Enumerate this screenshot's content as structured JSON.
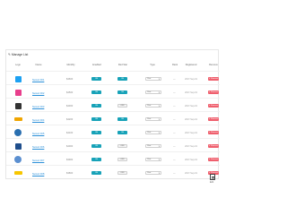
{
  "panel": {
    "title": "Manage List",
    "pencil_icon": "pencil-icon"
  },
  "columns": [
    "Logo",
    "Name",
    "Monthly",
    "Enabled",
    "Red Star",
    "Type",
    "Rank",
    "Registered",
    "Remove"
  ],
  "rows": [
    {
      "logo": {
        "icon": "twitter-logo",
        "color": "#1da1f2",
        "shape": "sq"
      },
      "name": "Netsol 001",
      "monthly": "$4600",
      "enabled": "ON",
      "redstar": "ON",
      "type": "Eco",
      "rank": "—",
      "date": "2017-Sep-01",
      "remove": "Remove"
    },
    {
      "logo": {
        "icon": "colorful-logo",
        "color": "#e83e8c",
        "shape": "sq"
      },
      "name": "Netsol 002",
      "monthly": "$4500",
      "enabled": "ON",
      "redstar": "ON",
      "type": "Eco",
      "rank": "—",
      "date": "2017-Sep-01",
      "remove": "Remove"
    },
    {
      "logo": {
        "icon": "b-logo",
        "color": "#333333",
        "shape": "sq"
      },
      "name": "Netsol 003",
      "monthly": "$4300",
      "enabled": "ON",
      "redstar": "OFF",
      "type": "Eco",
      "rank": "—",
      "date": "2017-Sep-01",
      "remove": "Remove"
    },
    {
      "logo": {
        "icon": "bar-logo",
        "color": "#f0a500",
        "shape": "bar"
      },
      "name": "Netsol 004",
      "monthly": "$4200",
      "enabled": "ON",
      "redstar": "ON",
      "type": "Eco",
      "rank": "—",
      "date": "2017-Sep-01",
      "remove": "Remove"
    },
    {
      "logo": {
        "icon": "circle-logo",
        "color": "#2a6fb0",
        "shape": "circ"
      },
      "name": "Netsol 005",
      "monthly": "$4100",
      "enabled": "ON",
      "redstar": "ON",
      "type": "Eco",
      "rank": "—",
      "date": "2017-Sep-01",
      "remove": "Remove"
    },
    {
      "logo": {
        "icon": "emblem-logo",
        "color": "#1f4e8c",
        "shape": "sq"
      },
      "name": "Netsol 006",
      "monthly": "$4000",
      "enabled": "ON",
      "redstar": "OFF",
      "type": "Eco",
      "rank": "—",
      "date": "2017-Sep-01",
      "remove": "Remove"
    },
    {
      "logo": {
        "icon": "round-logo",
        "color": "#5b8fd0",
        "shape": "circ"
      },
      "name": "Netsol 007",
      "monthly": "$3900",
      "enabled": "ON",
      "redstar": "OFF",
      "type": "Eco",
      "rank": "—",
      "date": "2017-Sep-01",
      "remove": "Remove"
    },
    {
      "logo": {
        "icon": "yellow-logo",
        "color": "#f7c600",
        "shape": "bar"
      },
      "name": "Netsol 008",
      "monthly": "$3800",
      "enabled": "ON",
      "redstar": "OFF",
      "type": "Eco",
      "rank": "—",
      "date": "2017-Sep-01",
      "remove": "Remove"
    }
  ],
  "corner": {
    "label": "Edit",
    "icon": "document-icon"
  },
  "colors": {
    "accent": "#17a2b8",
    "danger": "#ef5f6d",
    "link": "#2a8fd8"
  }
}
